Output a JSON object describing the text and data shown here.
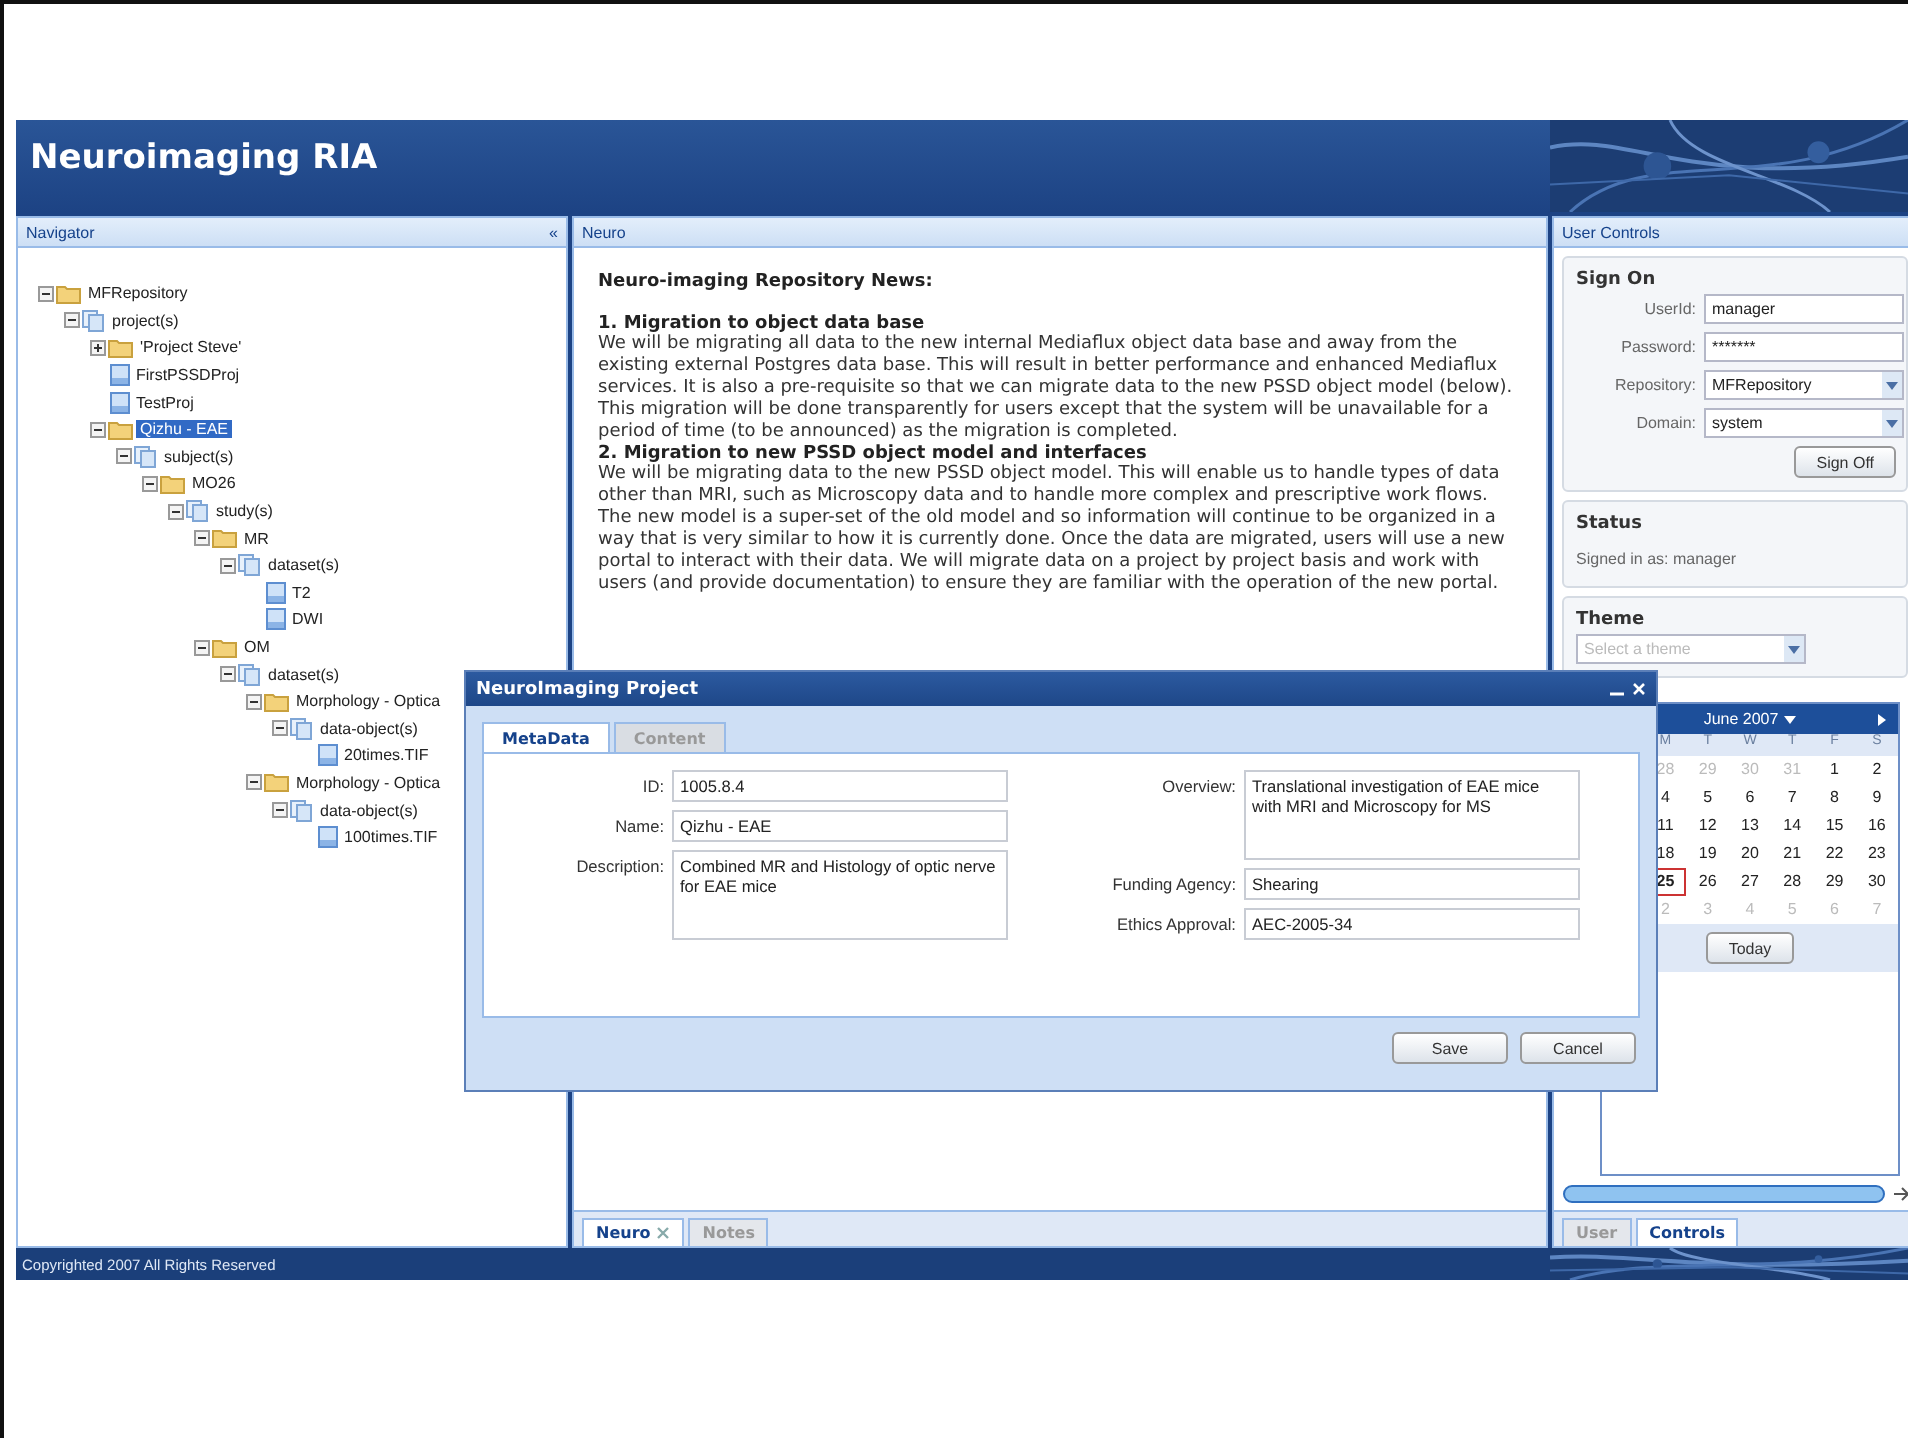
{
  "app_title": "Neuroimaging RIA",
  "navigator": {
    "title": "Navigator",
    "collapse": "«",
    "tree": [
      {
        "label": "MFRepository",
        "kind": "folder",
        "expanded": true,
        "selected": false,
        "children": [
          {
            "label": "project(s)",
            "kind": "group",
            "expanded": true,
            "selected": false,
            "children": [
              {
                "label": "'Project Steve'",
                "kind": "folder",
                "expanded": false,
                "selected": false
              },
              {
                "label": "FirstPSSDProj",
                "kind": "file",
                "selected": false
              },
              {
                "label": "TestProj",
                "kind": "file",
                "selected": false
              },
              {
                "label": "Qizhu - EAE",
                "kind": "folder",
                "expanded": true,
                "selected": true,
                "children": [
                  {
                    "label": "subject(s)",
                    "kind": "group",
                    "expanded": true,
                    "selected": false,
                    "children": [
                      {
                        "label": "MO26",
                        "kind": "folder",
                        "expanded": true,
                        "selected": false,
                        "children": [
                          {
                            "label": "study(s)",
                            "kind": "group",
                            "expanded": true,
                            "selected": false,
                            "children": [
                              {
                                "label": "MR",
                                "kind": "folder",
                                "expanded": true,
                                "selected": false,
                                "children": [
                                  {
                                    "label": "dataset(s)",
                                    "kind": "group",
                                    "expanded": true,
                                    "selected": false,
                                    "children": [
                                      {
                                        "label": "T2",
                                        "kind": "file",
                                        "selected": false
                                      },
                                      {
                                        "label": "DWI",
                                        "kind": "file",
                                        "selected": false
                                      }
                                    ]
                                  }
                                ]
                              },
                              {
                                "label": "OM",
                                "kind": "folder",
                                "expanded": true,
                                "selected": false,
                                "children": [
                                  {
                                    "label": "dataset(s)",
                                    "kind": "group",
                                    "expanded": true,
                                    "selected": false,
                                    "children": [
                                      {
                                        "label": "Morphology - Optica",
                                        "kind": "folder",
                                        "expanded": true,
                                        "selected": false,
                                        "children": [
                                          {
                                            "label": "data-object(s)",
                                            "kind": "group",
                                            "expanded": true,
                                            "selected": false,
                                            "children": [
                                              {
                                                "label": "20times.TIF",
                                                "kind": "file",
                                                "selected": false
                                              }
                                            ]
                                          }
                                        ]
                                      },
                                      {
                                        "label": "Morphology - Optica",
                                        "kind": "folder",
                                        "expanded": true,
                                        "selected": false,
                                        "children": [
                                          {
                                            "label": "data-object(s)",
                                            "kind": "group",
                                            "expanded": true,
                                            "selected": false,
                                            "children": [
                                              {
                                                "label": "100times.TIF",
                                                "kind": "file",
                                                "selected": false
                                              }
                                            ]
                                          }
                                        ]
                                      }
                                    ]
                                  }
                                ]
                              }
                            ]
                          }
                        ]
                      }
                    ]
                  }
                ]
              }
            ]
          }
        ]
      }
    ]
  },
  "center": {
    "title": "Neuro",
    "news": [
      {
        "kind": "heading",
        "text": "Neuro-imaging Repository News:"
      },
      {
        "kind": "subheading",
        "text": "1. Migration to object data base"
      },
      {
        "kind": "body",
        "text": "We will be migrating all data to the new internal Mediaflux object data base and away from the existing external Postgres data base. This will result in better performance and enhanced Mediaflux services. It is also a pre-requisite so that we can migrate data to the new PSSD object model (below). This migration will be done transparently for users except that the system will be unavailable for a period of time (to be announced) as the migration is completed."
      },
      {
        "kind": "subheading",
        "text": "2. Migration to new PSSD object model and interfaces"
      },
      {
        "kind": "body",
        "text": "We will be migrating data to the new PSSD object model. This will enable us to handle types of data other than MRI, such as Microscopy data and to handle more complex and prescriptive work flows. The new model is a super-set of the old model and so information will continue to be organized in a way that is very similar to how it is currently done. Once the data are migrated, users will use a new portal to interact with their data. We will migrate data on a project by project basis and work with users (and provide documentation) to ensure they are familiar with the operation of the new portal."
      }
    ],
    "tabs": [
      {
        "label": "Neuro",
        "selected": true,
        "closable": true
      },
      {
        "label": "Notes",
        "selected": false,
        "closable": false
      }
    ]
  },
  "user_controls": {
    "title": "User Controls",
    "sign_on": {
      "title": "Sign On",
      "fields": [
        {
          "label": "UserId:",
          "value": "manager",
          "dropdown": false
        },
        {
          "label": "Password:",
          "value": "*******",
          "dropdown": false
        },
        {
          "label": "Repository:",
          "value": "MFRepository",
          "dropdown": true
        },
        {
          "label": "Domain:",
          "value": "system",
          "dropdown": true
        }
      ],
      "button": "Sign Off"
    },
    "status": {
      "title": "Status",
      "text": "Signed in as: manager"
    },
    "theme": {
      "title": "Theme",
      "placeholder": "Select a theme"
    },
    "calendar": {
      "month": "June 2007",
      "weekdays": [
        "M",
        "T",
        "W",
        "T",
        "F",
        "S"
      ],
      "weeks": [
        [
          {
            "d": "28",
            "other": true,
            "selected": false
          },
          {
            "d": "29",
            "other": true,
            "selected": false
          },
          {
            "d": "30",
            "other": true,
            "selected": false
          },
          {
            "d": "31",
            "other": true,
            "selected": false
          },
          {
            "d": "1",
            "other": false,
            "selected": false
          },
          {
            "d": "2",
            "other": false,
            "selected": false
          }
        ],
        [
          {
            "d": "4",
            "other": false,
            "selected": false
          },
          {
            "d": "5",
            "other": false,
            "selected": false
          },
          {
            "d": "6",
            "other": false,
            "selected": false
          },
          {
            "d": "7",
            "other": false,
            "selected": false
          },
          {
            "d": "8",
            "other": false,
            "selected": false
          },
          {
            "d": "9",
            "other": false,
            "selected": false
          }
        ],
        [
          {
            "d": "11",
            "other": false,
            "selected": false
          },
          {
            "d": "12",
            "other": false,
            "selected": false
          },
          {
            "d": "13",
            "other": false,
            "selected": false
          },
          {
            "d": "14",
            "other": false,
            "selected": false
          },
          {
            "d": "15",
            "other": false,
            "selected": false
          },
          {
            "d": "16",
            "other": false,
            "selected": false
          }
        ],
        [
          {
            "d": "18",
            "other": false,
            "selected": false
          },
          {
            "d": "19",
            "other": false,
            "selected": false
          },
          {
            "d": "20",
            "other": false,
            "selected": false
          },
          {
            "d": "21",
            "other": false,
            "selected": false
          },
          {
            "d": "22",
            "other": false,
            "selected": false
          },
          {
            "d": "23",
            "other": false,
            "selected": false
          }
        ],
        [
          {
            "d": "25",
            "other": false,
            "selected": true
          },
          {
            "d": "26",
            "other": false,
            "selected": false
          },
          {
            "d": "27",
            "other": false,
            "selected": false
          },
          {
            "d": "28",
            "other": false,
            "selected": false
          },
          {
            "d": "29",
            "other": false,
            "selected": false
          },
          {
            "d": "30",
            "other": false,
            "selected": false
          }
        ],
        [
          {
            "d": "2",
            "other": true,
            "selected": false
          },
          {
            "d": "3",
            "other": true,
            "selected": false
          },
          {
            "d": "4",
            "other": true,
            "selected": false
          },
          {
            "d": "5",
            "other": true,
            "selected": false
          },
          {
            "d": "6",
            "other": true,
            "selected": false
          },
          {
            "d": "7",
            "other": true,
            "selected": false
          }
        ]
      ],
      "today": "Today"
    },
    "tabs": [
      {
        "label": "User",
        "selected": false
      },
      {
        "label": "Controls",
        "selected": true
      }
    ]
  },
  "dialog": {
    "title": "NeuroImaging Project",
    "tabs": [
      {
        "label": "MetaData",
        "selected": true
      },
      {
        "label": "Content",
        "selected": false
      }
    ],
    "left_fields": [
      {
        "label": "ID:",
        "value": "1005.8.4",
        "kind": "text"
      },
      {
        "label": "Name:",
        "value": "Qizhu - EAE",
        "kind": "text"
      },
      {
        "label": "Description:",
        "value": "Combined MR and Histology of optic nerve for EAE mice",
        "kind": "area"
      }
    ],
    "right_fields": [
      {
        "label": "Overview:",
        "value": "Translational investigation of EAE mice with MRI and Microscopy for MS",
        "kind": "area"
      },
      {
        "label": "Funding Agency:",
        "value": "Shearing",
        "kind": "text"
      },
      {
        "label": "Ethics Approval:",
        "value": "AEC-2005-34",
        "kind": "text"
      }
    ],
    "buttons": [
      "Save",
      "Cancel"
    ]
  },
  "footer": "Copyrighted 2007 All Rights Reserved"
}
